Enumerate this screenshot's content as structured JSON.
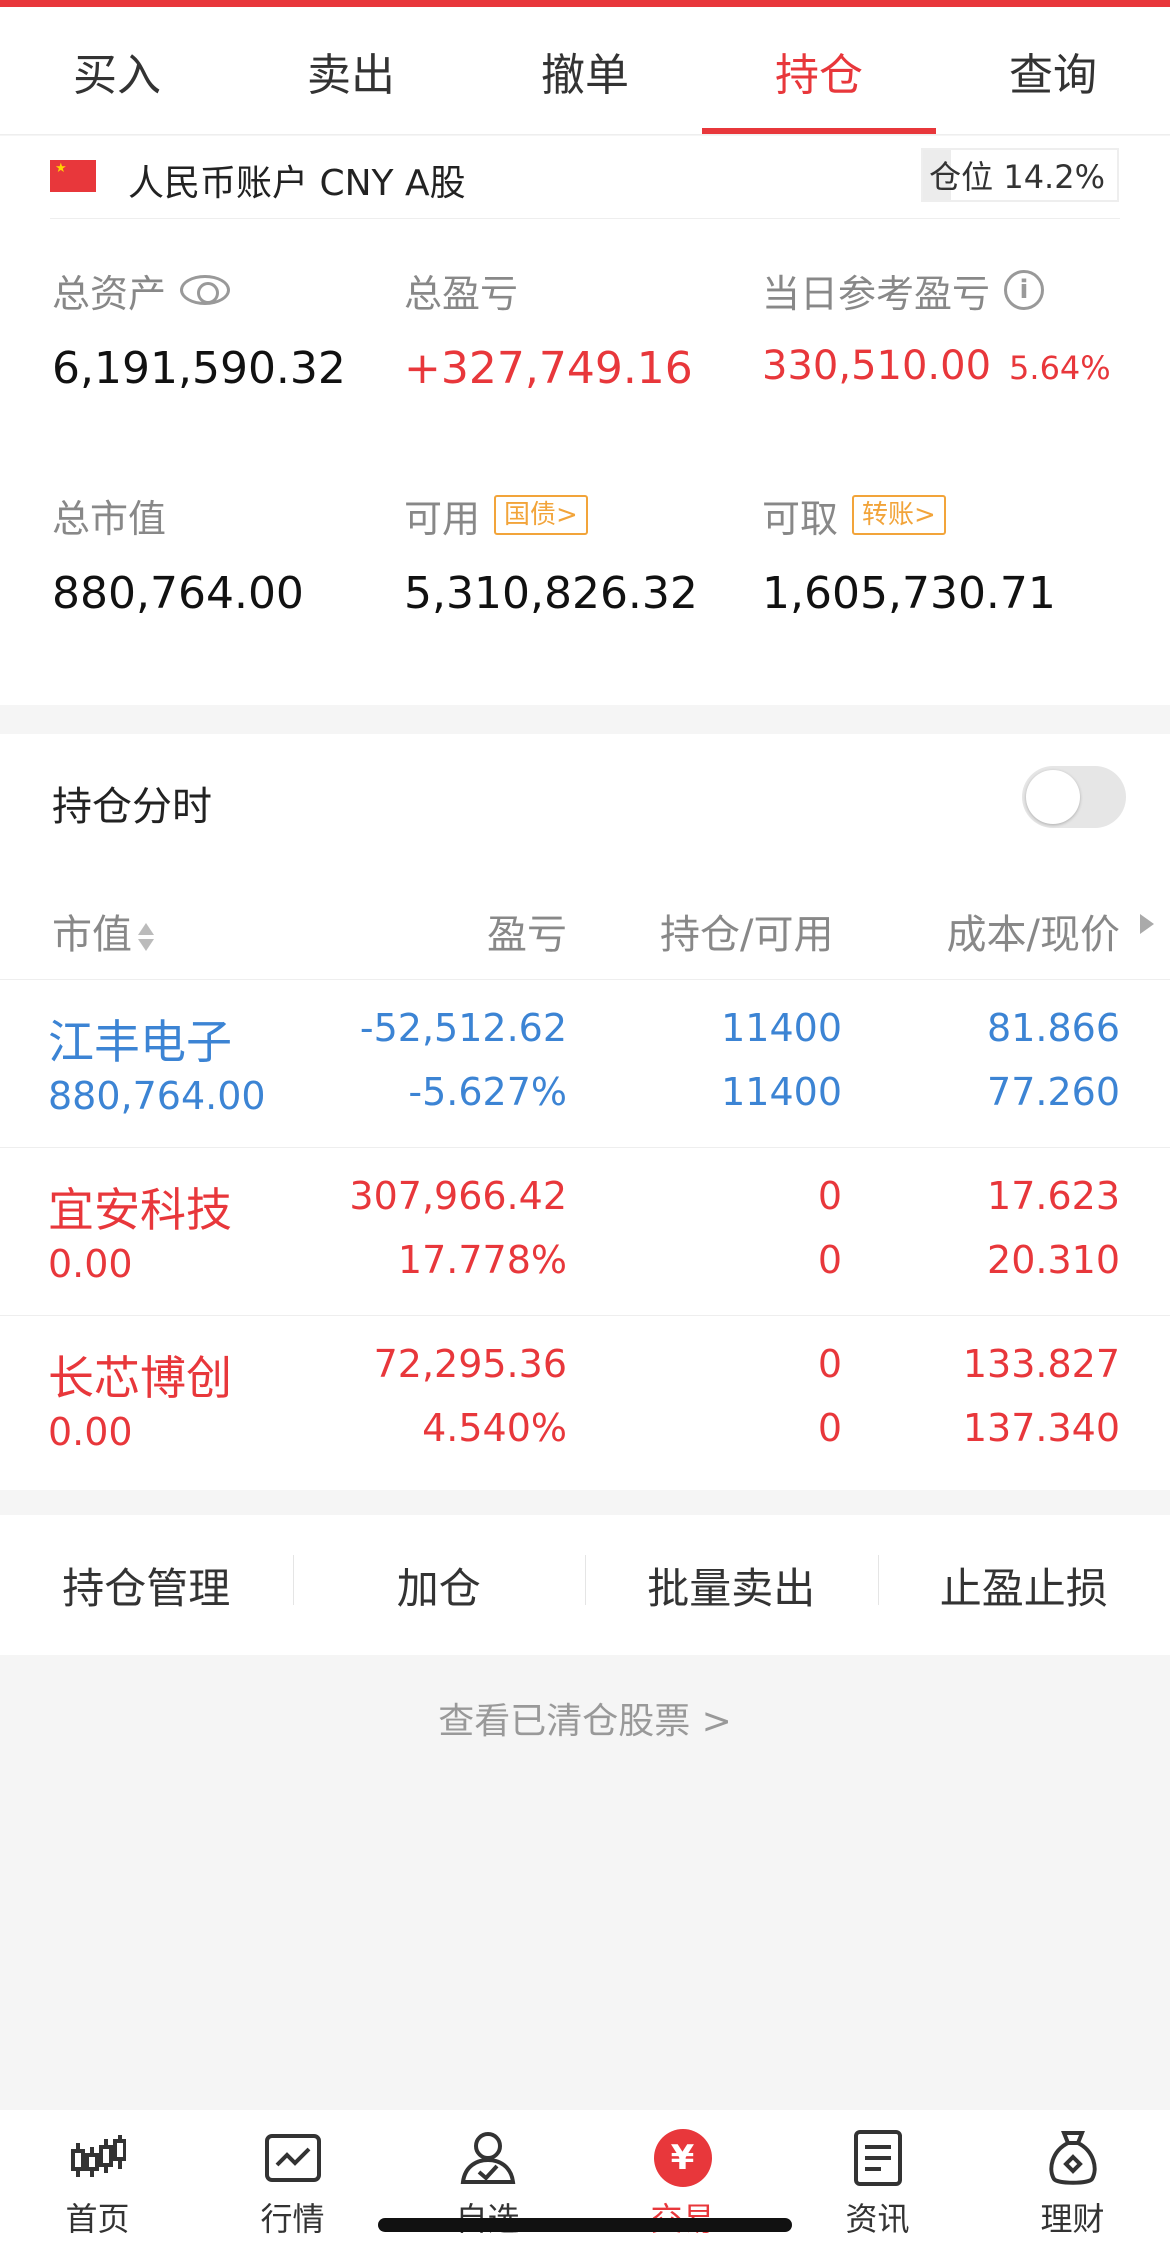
{
  "tabs": [
    {
      "label": "买入"
    },
    {
      "label": "卖出"
    },
    {
      "label": "撤单"
    },
    {
      "label": "持仓"
    },
    {
      "label": "查询"
    }
  ],
  "active_tab": 3,
  "account": {
    "name": "人民币账户 CNY A股",
    "position_label": "仓位 14.2%",
    "position_ratio": 0.142
  },
  "summary": {
    "total_assets_label": "总资产",
    "total_assets": "6,191,590.32",
    "total_pl_label": "总盈亏",
    "total_pl": "+327,749.16",
    "daily_pl_label": "当日参考盈亏",
    "daily_pl": "330,510.00",
    "daily_pl_pct": "5.64%",
    "market_value_label": "总市值",
    "market_value": "880,764.00",
    "available_label": "可用",
    "available_tag": "国债>",
    "available": "5,310,826.32",
    "withdrawable_label": "可取",
    "withdrawable_tag": "转账>",
    "withdrawable": "1,605,730.71"
  },
  "holdings": {
    "title": "持仓分时",
    "toggle_on": false,
    "headers": {
      "market_value": "市值",
      "pl": "盈亏",
      "qty": "持仓/可用",
      "price": "成本/现价"
    },
    "rows": [
      {
        "name": "江丰电子",
        "market_value": "880,764.00",
        "pl": "-52,512.62",
        "pl_pct": "-5.627%",
        "qty": "11400",
        "available": "11400",
        "cost": "81.866",
        "price": "77.260",
        "color": "#3c84d4"
      },
      {
        "name": "宜安科技",
        "market_value": "0.00",
        "pl": "307,966.42",
        "pl_pct": "17.778%",
        "qty": "0",
        "available": "0",
        "cost": "17.623",
        "price": "20.310",
        "color": "#e8373b"
      },
      {
        "name": "长芯博创",
        "market_value": "0.00",
        "pl": "72,295.36",
        "pl_pct": "4.540%",
        "qty": "0",
        "available": "0",
        "cost": "133.827",
        "price": "137.340",
        "color": "#e8373b"
      }
    ]
  },
  "actions": [
    {
      "label": "持仓管理"
    },
    {
      "label": "加仓"
    },
    {
      "label": "批量卖出"
    },
    {
      "label": "止盈止损"
    }
  ],
  "cleared_link": "查看已清仓股票 >",
  "nav": [
    {
      "label": "首页",
      "icon": "candlestick-icon"
    },
    {
      "label": "行情",
      "icon": "chart-icon"
    },
    {
      "label": "自选",
      "icon": "user-check-icon"
    },
    {
      "label": "交易",
      "icon": "yen-icon",
      "icon_text": "¥"
    },
    {
      "label": "资讯",
      "icon": "document-icon"
    },
    {
      "label": "理财",
      "icon": "money-bag-icon"
    }
  ],
  "colors": {
    "accent": "#e8373b",
    "down": "#3c84d4",
    "tag": "#f2a43a"
  }
}
